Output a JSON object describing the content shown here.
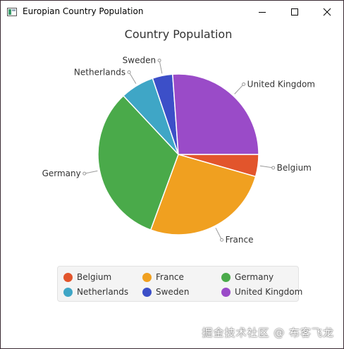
{
  "window": {
    "title": "Europian Country Population",
    "controls": [
      "minimize-icon",
      "maximize-icon",
      "close-icon"
    ]
  },
  "chart_data": {
    "type": "pie",
    "title": "Country Population",
    "categories": [
      "Belgium",
      "France",
      "Germany",
      "Netherlands",
      "Sweden",
      "United Kingdom"
    ],
    "values": [
      11.4,
      67.0,
      83.1,
      17.4,
      10.4,
      67.0
    ],
    "legend": "bottom",
    "colors": [
      "#e2552c",
      "#f0a020",
      "#4aaa4a",
      "#3fa6c6",
      "#3c4fc8",
      "#9a4bc8"
    ],
    "start_direction": "east",
    "direction": "clockwise"
  },
  "legend": {
    "items": [
      "Belgium",
      "France",
      "Germany",
      "Netherlands",
      "Sweden",
      "United Kingdom"
    ]
  },
  "watermark": "掘金技术社区 @ 布客飞龙"
}
